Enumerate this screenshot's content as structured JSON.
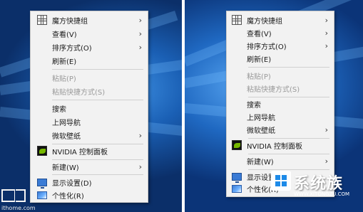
{
  "menu_left": {
    "items": [
      {
        "label": "魔方快捷组",
        "icon": "grid-icon",
        "arrow": "›"
      },
      {
        "label": "查看(V)",
        "arrow": "›"
      },
      {
        "label": "排序方式(O)",
        "arrow": "›"
      },
      {
        "label": "刷新(E)"
      },
      {
        "label": "粘贴(P)",
        "disabled": true
      },
      {
        "label": "粘贴快捷方式(S)",
        "disabled": true
      },
      {
        "label": "搜索"
      },
      {
        "label": "上网导航"
      },
      {
        "label": "微软壁纸",
        "arrow": "›"
      },
      {
        "label": "NVIDIA 控制面板",
        "icon": "nvidia-icon"
      },
      {
        "label": "新建(W)",
        "arrow": "›"
      },
      {
        "label": "显示设置(D)",
        "icon": "display-settings-icon"
      },
      {
        "label": "个性化(R)",
        "icon": "personalize-icon"
      }
    ]
  },
  "menu_right": {
    "items": [
      {
        "label": "魔方快捷组",
        "icon": "grid-icon",
        "arrow": "›"
      },
      {
        "label": "查看(V)",
        "arrow": "›"
      },
      {
        "label": "排序方式(O)",
        "arrow": "›"
      },
      {
        "label": "刷新(E)"
      },
      {
        "label": "粘贴(P)",
        "disabled": true
      },
      {
        "label": "粘贴快捷方式(S)",
        "disabled": true
      },
      {
        "label": "搜索"
      },
      {
        "label": "上网导航"
      },
      {
        "label": "微软壁纸",
        "arrow": "›"
      },
      {
        "label": "NVIDIA 控制面板",
        "icon": "nvidia-icon"
      },
      {
        "label": "新建(W)",
        "arrow": "›"
      },
      {
        "label": "显示设置(D)",
        "icon": "display-settings-icon"
      },
      {
        "label": "个性化(R)",
        "icon": "personalize-icon"
      }
    ]
  },
  "watermark_left": {
    "url": "ithome.com"
  },
  "watermark_right": {
    "brand": "系统族",
    "url": "WWW.XITONGZU.COM"
  },
  "colors": {
    "menu_bg": "#f2f2f2",
    "disabled_text": "#9a9a9a",
    "desktop_blue": "#1a5fb4"
  }
}
